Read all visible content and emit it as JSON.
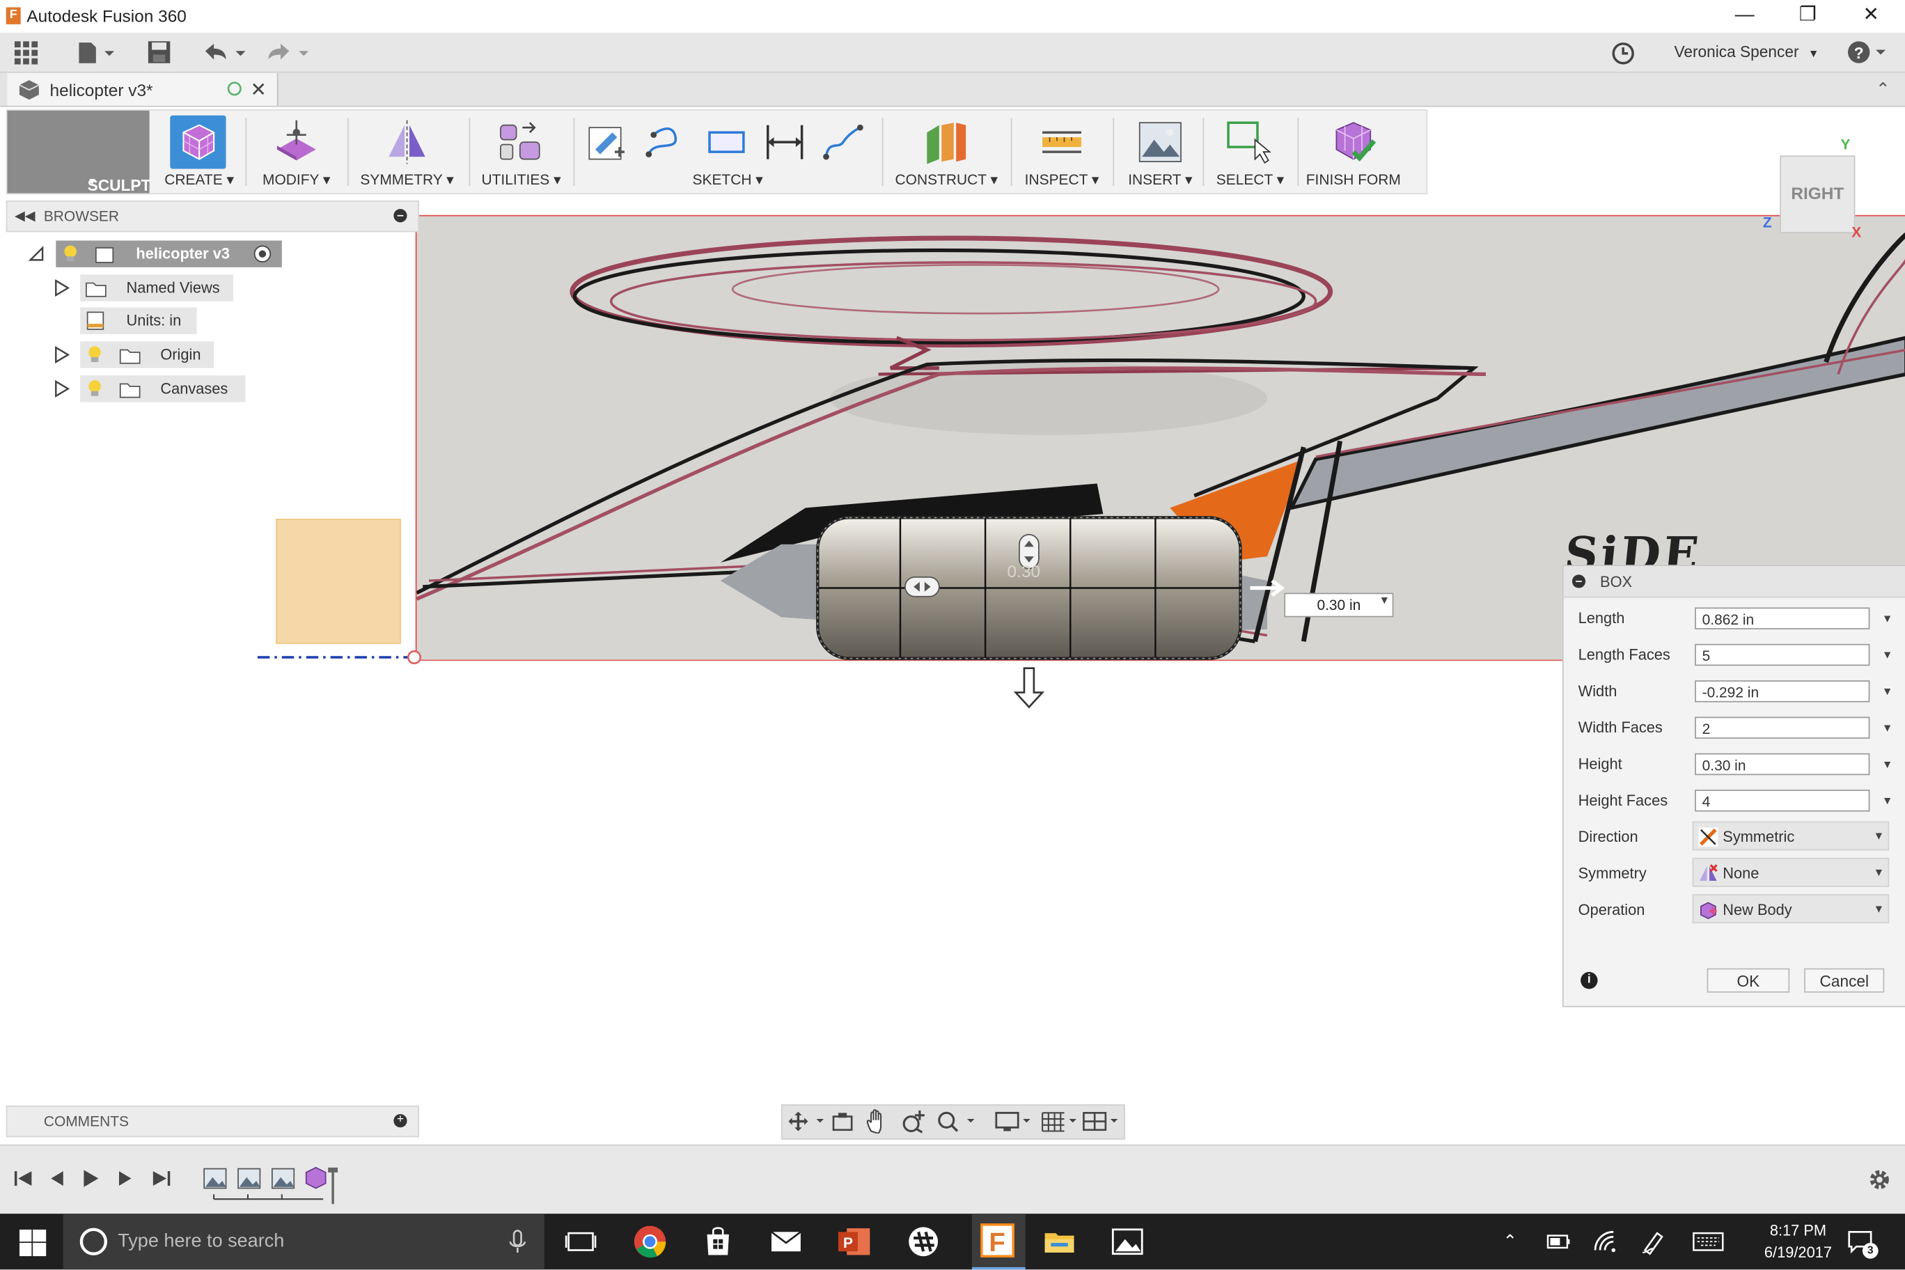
{
  "window": {
    "title": "Autodesk Fusion 360",
    "app_icon_letter": "F"
  },
  "quick_access": {
    "user_name": "Veronica Spencer"
  },
  "document_tab": {
    "name": "helicopter v3*"
  },
  "toolbar": {
    "workspace": "SCULPT",
    "groups": [
      "CREATE",
      "MODIFY",
      "SYMMETRY",
      "UTILITIES",
      "SKETCH",
      "CONSTRUCT",
      "INSPECT",
      "INSERT",
      "SELECT",
      "FINISH FORM"
    ]
  },
  "browser": {
    "header": "BROWSER",
    "root": "helicopter v3",
    "items": [
      "Named Views",
      "Units: in",
      "Origin",
      "Canvases"
    ]
  },
  "viewcube": {
    "face": "RIGHT",
    "axis_y": "Y",
    "axis_z": "Z",
    "axis_x": "X"
  },
  "canvas": {
    "sketch_text": "SiDE",
    "manipulator_value": "0.30",
    "height_input": "0.30 in"
  },
  "box_dialog": {
    "title": "BOX",
    "fields": [
      {
        "label": "Length",
        "value": "0.862 in"
      },
      {
        "label": "Length Faces",
        "value": "5"
      },
      {
        "label": "Width",
        "value": "-0.292 in"
      },
      {
        "label": "Width Faces",
        "value": "2"
      },
      {
        "label": "Height",
        "value": "0.30 in"
      },
      {
        "label": "Height Faces",
        "value": "4"
      }
    ],
    "selects": [
      {
        "label": "Direction",
        "value": "Symmetric"
      },
      {
        "label": "Symmetry",
        "value": "None"
      },
      {
        "label": "Operation",
        "value": "New Body"
      }
    ],
    "ok": "OK",
    "cancel": "Cancel"
  },
  "comments": {
    "header": "COMMENTS"
  },
  "taskbar": {
    "search_placeholder": "Type here to search",
    "time": "8:17 PM",
    "date": "6/19/2017",
    "notification_count": "3"
  },
  "colors": {
    "accent": "#2f7bd8",
    "sculpt_bg": "#8b8b8b",
    "taskbar": "#1f1f1f",
    "canvas_border": "#e14b4b"
  }
}
